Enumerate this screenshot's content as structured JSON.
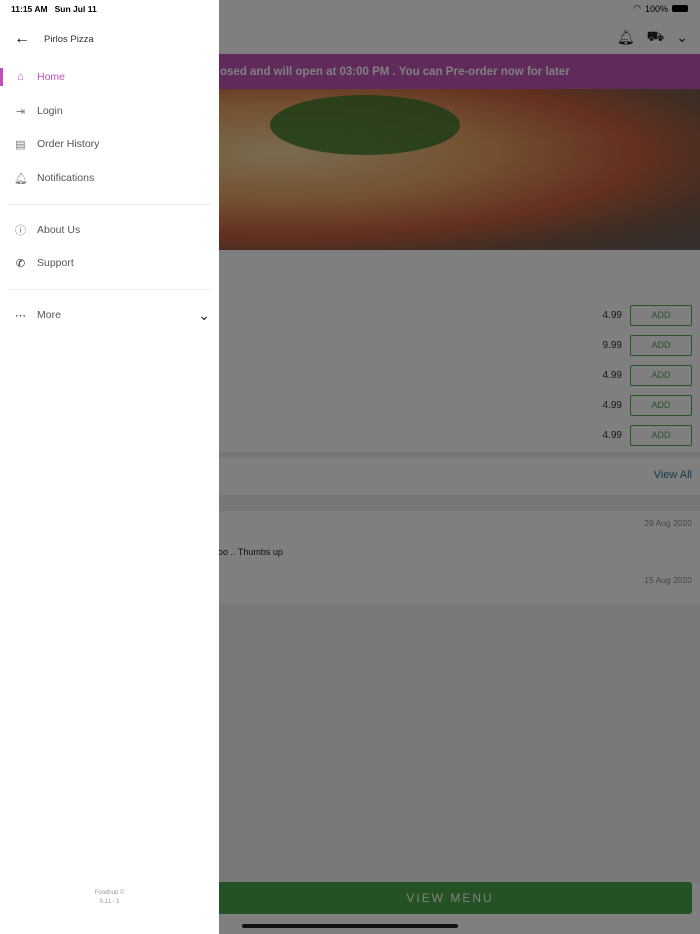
{
  "status": {
    "time": "11:15 AM",
    "date": "Sun Jul 11",
    "battery": "100%"
  },
  "drawer": {
    "title": "Pirlos Pizza",
    "items": [
      {
        "label": "Home",
        "icon": "home-icon"
      },
      {
        "label": "Login",
        "icon": "login-icon"
      },
      {
        "label": "Order History",
        "icon": "receipt-icon"
      },
      {
        "label": "Notifications",
        "icon": "bell-icon"
      },
      {
        "label": "About Us",
        "icon": "info-icon"
      },
      {
        "label": "Support",
        "icon": "phone-icon"
      },
      {
        "label": "More",
        "icon": "more-icon"
      }
    ],
    "footer": {
      "brand": "Foodhub ©",
      "version": "9.11 - 1"
    }
  },
  "main": {
    "banner": "osed and will open at 03:00 PM . You can Pre-order now for later",
    "items": [
      {
        "price": "4.99",
        "button": "ADD"
      },
      {
        "price": "9.99",
        "button": "ADD"
      },
      {
        "price": "4.99",
        "button": "ADD"
      },
      {
        "price": "4.99",
        "button": "ADD"
      },
      {
        "price": "4.99",
        "button": "ADD"
      }
    ],
    "view_all": "View All",
    "reviews": [
      {
        "date": "29 Aug 2020",
        "text": "oo .. Thumbs up"
      },
      {
        "date": "15 Aug 2020"
      }
    ],
    "view_menu": "VIEW MENU"
  },
  "colors": {
    "accent": "#c050b8",
    "green": "#4caa50"
  }
}
